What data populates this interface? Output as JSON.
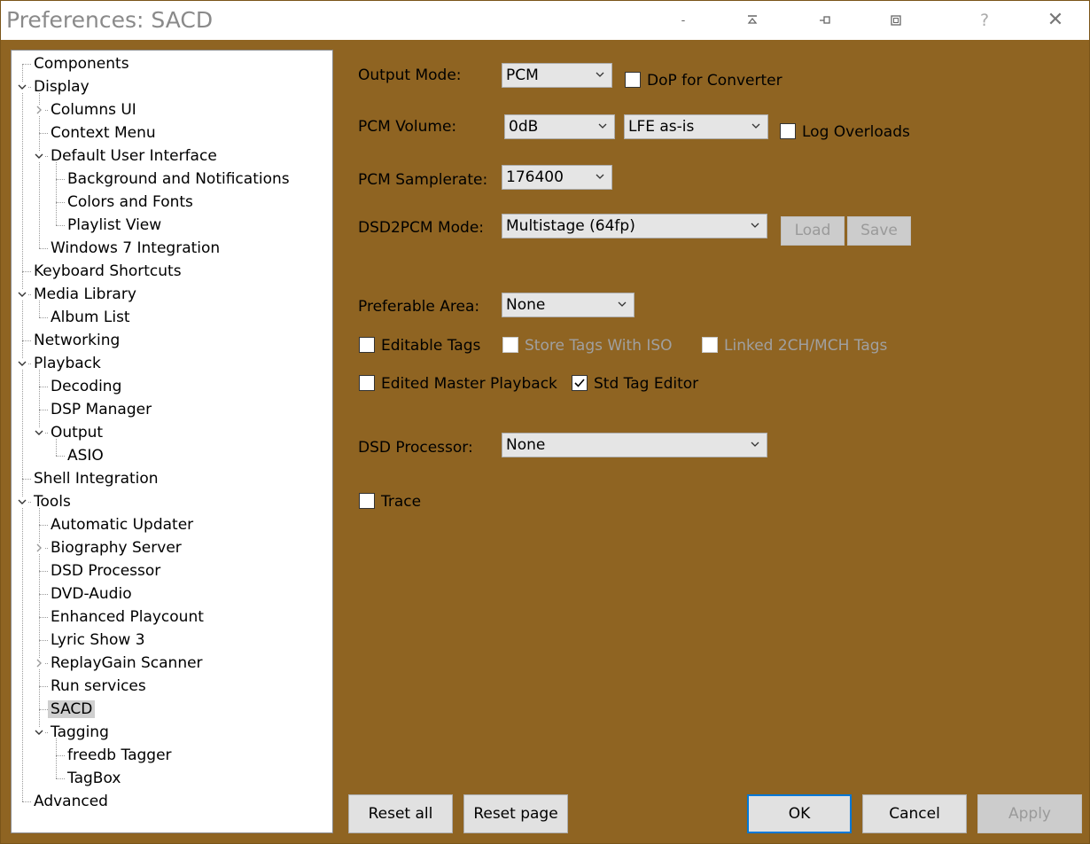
{
  "window": {
    "title": "Preferences: SACD",
    "controls": {
      "minimize": "-",
      "help": "?",
      "close": "✕"
    }
  },
  "tree": [
    {
      "label": "Components",
      "level": 0,
      "expander": "none"
    },
    {
      "label": "Display",
      "level": 0,
      "expander": "expanded"
    },
    {
      "label": "Columns UI",
      "level": 1,
      "expander": "collapsed"
    },
    {
      "label": "Context Menu",
      "level": 1,
      "expander": "none"
    },
    {
      "label": "Default User Interface",
      "level": 1,
      "expander": "expanded"
    },
    {
      "label": "Background and Notifications",
      "level": 2,
      "expander": "none"
    },
    {
      "label": "Colors and Fonts",
      "level": 2,
      "expander": "none"
    },
    {
      "label": "Playlist View",
      "level": 2,
      "expander": "none"
    },
    {
      "label": "Windows 7 Integration",
      "level": 1,
      "expander": "none"
    },
    {
      "label": "Keyboard Shortcuts",
      "level": 0,
      "expander": "none"
    },
    {
      "label": "Media Library",
      "level": 0,
      "expander": "expanded"
    },
    {
      "label": "Album List",
      "level": 1,
      "expander": "none"
    },
    {
      "label": "Networking",
      "level": 0,
      "expander": "none"
    },
    {
      "label": "Playback",
      "level": 0,
      "expander": "expanded"
    },
    {
      "label": "Decoding",
      "level": 1,
      "expander": "none"
    },
    {
      "label": "DSP Manager",
      "level": 1,
      "expander": "none"
    },
    {
      "label": "Output",
      "level": 1,
      "expander": "expanded"
    },
    {
      "label": "ASIO",
      "level": 2,
      "expander": "none"
    },
    {
      "label": "Shell Integration",
      "level": 0,
      "expander": "none"
    },
    {
      "label": "Tools",
      "level": 0,
      "expander": "expanded"
    },
    {
      "label": "Automatic Updater",
      "level": 1,
      "expander": "none"
    },
    {
      "label": "Biography Server",
      "level": 1,
      "expander": "collapsed"
    },
    {
      "label": "DSD Processor",
      "level": 1,
      "expander": "none"
    },
    {
      "label": "DVD-Audio",
      "level": 1,
      "expander": "none"
    },
    {
      "label": "Enhanced Playcount",
      "level": 1,
      "expander": "none"
    },
    {
      "label": "Lyric Show 3",
      "level": 1,
      "expander": "none"
    },
    {
      "label": "ReplayGain Scanner",
      "level": 1,
      "expander": "collapsed"
    },
    {
      "label": "Run services",
      "level": 1,
      "expander": "none"
    },
    {
      "label": "SACD",
      "level": 1,
      "expander": "none",
      "selected": true
    },
    {
      "label": "Tagging",
      "level": 1,
      "expander": "expanded"
    },
    {
      "label": "freedb Tagger",
      "level": 2,
      "expander": "none"
    },
    {
      "label": "TagBox",
      "level": 2,
      "expander": "none"
    },
    {
      "label": "Advanced",
      "level": 0,
      "expander": "none"
    }
  ],
  "settings": {
    "output_mode_label": "Output Mode:",
    "output_mode_value": "PCM",
    "dop_label": "DoP for Converter",
    "dop_checked": false,
    "pcm_volume_label": "PCM Volume:",
    "pcm_volume_value": "0dB",
    "lfe_value": "LFE as-is",
    "log_overloads_label": "Log Overloads",
    "log_overloads_checked": false,
    "pcm_samplerate_label": "PCM Samplerate:",
    "pcm_samplerate_value": "176400",
    "dsd2pcm_label": "DSD2PCM Mode:",
    "dsd2pcm_value": "Multistage (64fp)",
    "load_label": "Load",
    "save_label": "Save",
    "preferable_area_label": "Preferable Area:",
    "preferable_area_value": "None",
    "editable_tags_label": "Editable Tags",
    "editable_tags_checked": false,
    "store_tags_label": "Store Tags With ISO",
    "linked_tags_label": "Linked 2CH/MCH Tags",
    "edited_master_label": "Edited Master Playback",
    "edited_master_checked": false,
    "std_tag_editor_label": "Std Tag Editor",
    "std_tag_editor_checked": true,
    "dsd_processor_label": "DSD Processor:",
    "dsd_processor_value": "None",
    "trace_label": "Trace",
    "trace_checked": false
  },
  "footer": {
    "reset_all": "Reset all",
    "reset_page": "Reset page",
    "ok": "OK",
    "cancel": "Cancel",
    "apply": "Apply"
  },
  "colors": {
    "panel_bg": "#8f6422",
    "selection": "#cfcfcf",
    "default_button_border": "#0078d7"
  }
}
